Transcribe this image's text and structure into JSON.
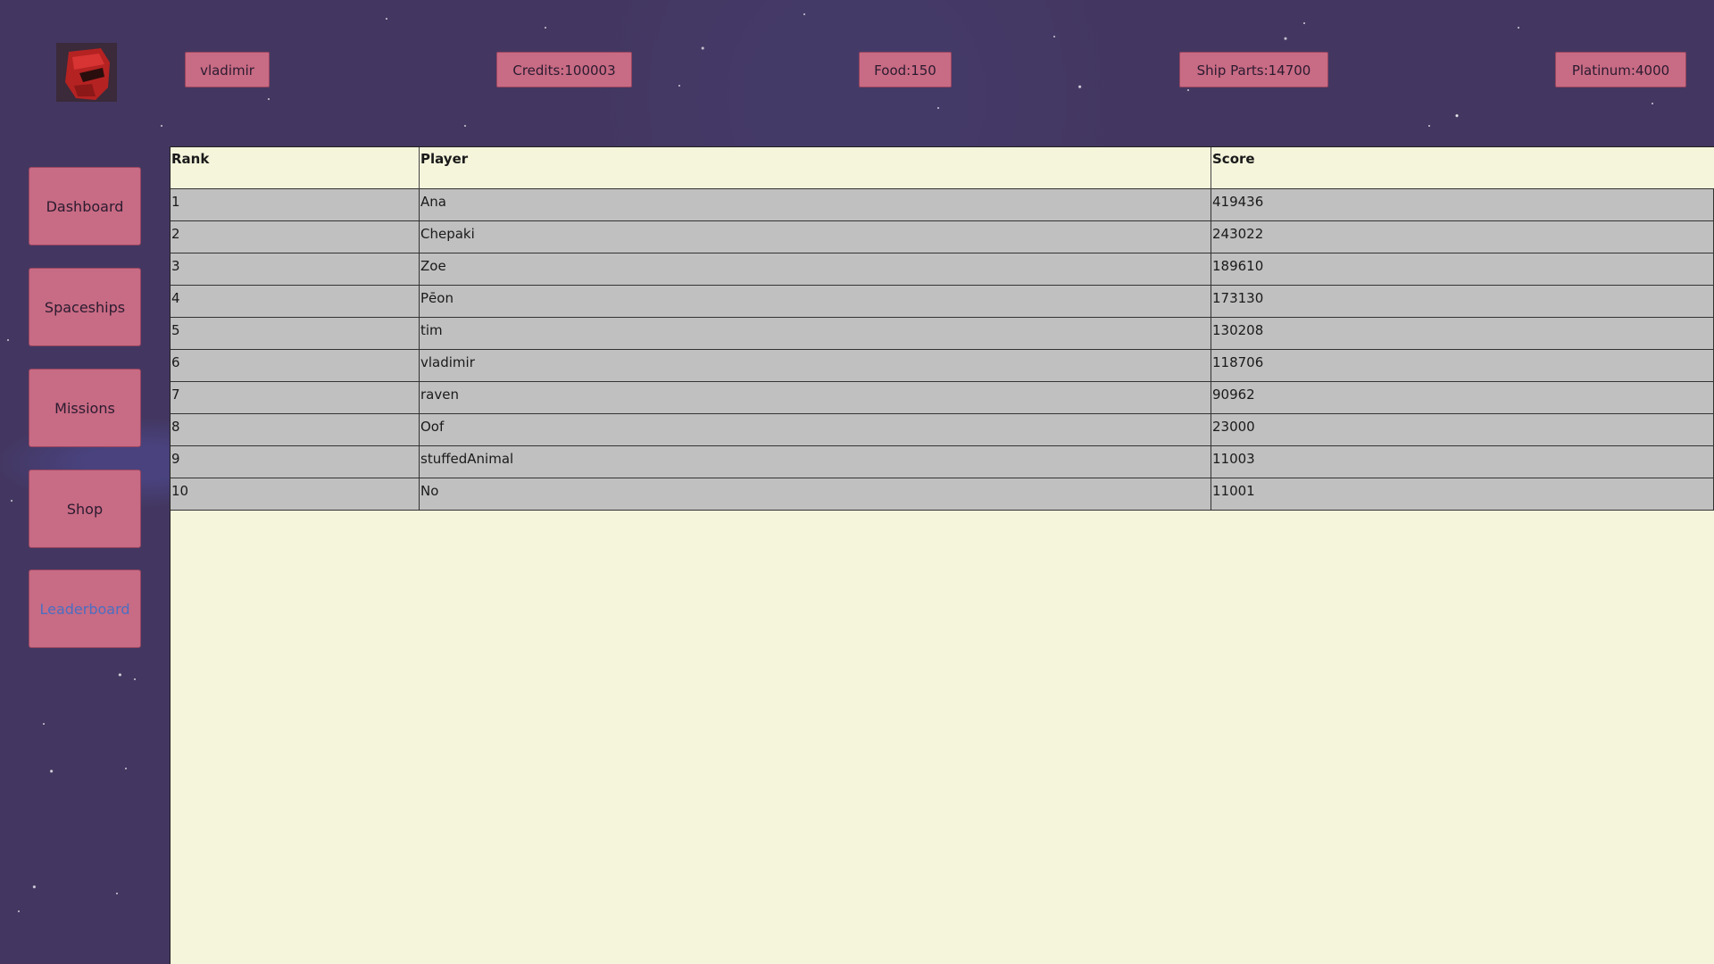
{
  "header": {
    "username": "vladimir",
    "credits": "Credits:100003",
    "food": "Food:150",
    "ship_parts": "Ship Parts:14700",
    "platinum": "Platinum:4000"
  },
  "nav": {
    "items": [
      {
        "label": "Dashboard"
      },
      {
        "label": "Spaceships"
      },
      {
        "label": "Missions"
      },
      {
        "label": "Shop"
      },
      {
        "label": "Leaderboard",
        "active": true
      }
    ]
  },
  "leaderboard": {
    "headers": [
      "Rank",
      "Player",
      "Score"
    ],
    "rows": [
      [
        "1",
        "Ana",
        "419436"
      ],
      [
        "2",
        "Chepaki",
        "243022"
      ],
      [
        "3",
        "Zoe",
        "189610"
      ],
      [
        "4",
        "Pēon",
        "173130"
      ],
      [
        "5",
        "tim",
        "130208"
      ],
      [
        "6",
        "vladimir",
        "118706"
      ],
      [
        "7",
        "raven",
        "90962"
      ],
      [
        "8",
        "Oof",
        "23000"
      ],
      [
        "9",
        "stuffedAnimal",
        "11003"
      ],
      [
        "10",
        "No",
        "11001"
      ]
    ]
  },
  "colors": {
    "background": "#433761",
    "button": "#c86b84",
    "panel": "#f5f5dc",
    "row": "#c0c0c0",
    "active_nav_text": "#4a6fc2"
  },
  "icons": {
    "logo": "red-helmet-avatar-icon"
  }
}
